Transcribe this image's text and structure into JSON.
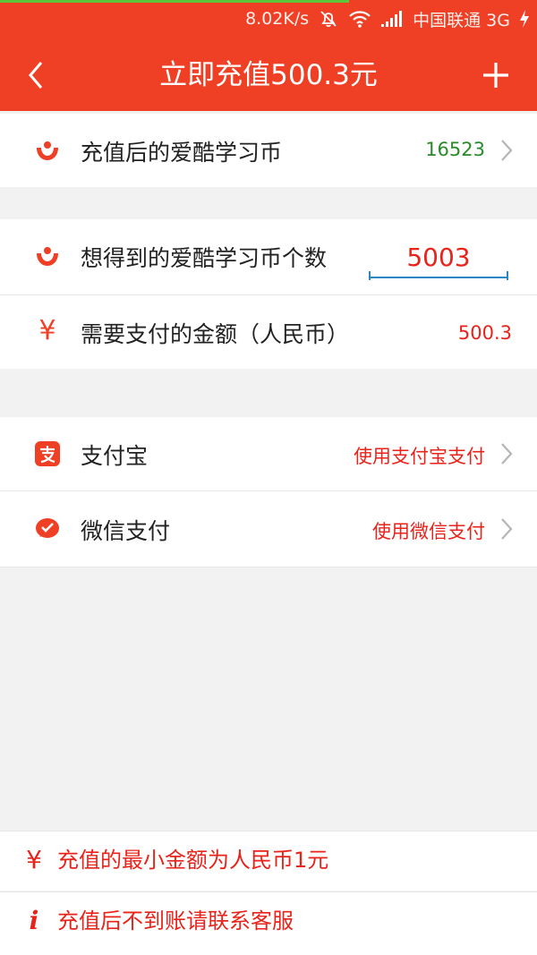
{
  "status_bar": {
    "speed": "8.02K/s",
    "carrier": "中国联通 3G"
  },
  "header": {
    "title": "立即充值500.3元"
  },
  "balance": {
    "label": "充值后的爱酷学习币",
    "value": "16523"
  },
  "purchase": {
    "coins_label": "想得到的爱酷学习币个数",
    "coins_value": "5003",
    "pay_label": "需要支付的金额（人民币）",
    "pay_value": "500.3",
    "yuan_symbol": "¥"
  },
  "payment_methods": [
    {
      "label": "支付宝",
      "action": "使用支付宝支付",
      "icon": "alipay-icon"
    },
    {
      "label": "微信支付",
      "action": "使用微信支付",
      "icon": "wechat-pay-icon"
    }
  ],
  "notes": [
    {
      "icon": "yuan-icon",
      "symbol": "¥",
      "text": "充值的最小金额为人民币1元"
    },
    {
      "icon": "info-icon",
      "symbol": "i",
      "text": "充值后不到账请联系客服"
    }
  ],
  "colors": {
    "accent": "#ef3f24",
    "value_green": "#2a8a2a",
    "value_red": "#e8231a",
    "input_underline": "#2a87c8"
  }
}
